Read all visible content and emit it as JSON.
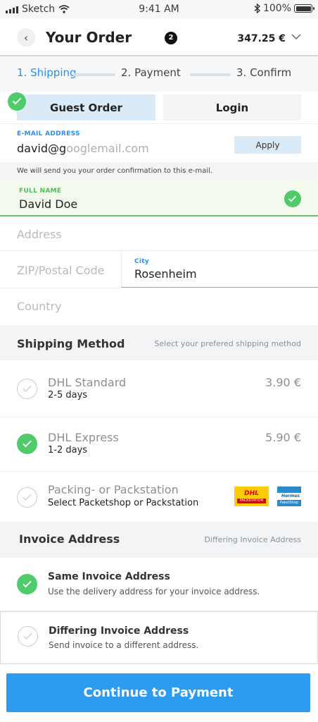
{
  "status_bar": {
    "carrier": "Sketch",
    "time": "9:41 AM",
    "battery": "100%"
  },
  "header": {
    "title": "Your Order",
    "cart_count": "2",
    "total": "347.25 €"
  },
  "steps": [
    {
      "label": "1. Shipping",
      "active": true
    },
    {
      "label": "2. Payment",
      "active": false
    },
    {
      "label": "3. Confirm",
      "active": false
    }
  ],
  "account_toggle": {
    "guest_label": "Guest Order",
    "login_label": "Login",
    "selected": "guest"
  },
  "email": {
    "label": "E-MAIL ADDRESS",
    "typed": "david@g",
    "suggestion": "ooglemail.com",
    "apply_label": "Apply",
    "hint": "We will send you your order confirmation to this e-mail."
  },
  "full_name": {
    "label": "FULL NAME",
    "value": "David Doe",
    "valid": true
  },
  "address": {
    "placeholder": "Address"
  },
  "zip": {
    "placeholder": "ZIP/Postal Code"
  },
  "city": {
    "label": "City",
    "value": "Rosenheim"
  },
  "country": {
    "placeholder": "Country"
  },
  "shipping": {
    "heading": "Shipping Method",
    "subheading": "Select your prefered shipping method",
    "options": [
      {
        "name": "DHL Standard",
        "desc": "2-5 days",
        "price": "3.90 €",
        "selected": false
      },
      {
        "name": "DHL Express",
        "desc": "1-2 days",
        "price": "5.90 €",
        "selected": true
      },
      {
        "name": "Packing- or Packstation",
        "desc": "Select Packetshop or Packstation",
        "selected": false,
        "logos": {
          "dhl_top": "DHL",
          "dhl_bottom": "PACKSTATION",
          "hermes_top": "Hermes",
          "hermes_bottom": "PaketShop"
        }
      }
    ]
  },
  "invoice": {
    "heading": "Invoice Address",
    "subheading": "Differing Invoice Address",
    "options": [
      {
        "name": "Same Invoice Address",
        "desc": "Use the delivery address for your invoice address.",
        "selected": true
      },
      {
        "name": "Differing Invoice Address",
        "desc": "Send invoice to a different address.",
        "selected": false
      }
    ]
  },
  "cta": {
    "label": "Continue to Payment"
  },
  "colors": {
    "accent_blue": "#2d9cf0",
    "success_green": "#4fcb6a",
    "dhl_yellow": "#ffcb05"
  }
}
